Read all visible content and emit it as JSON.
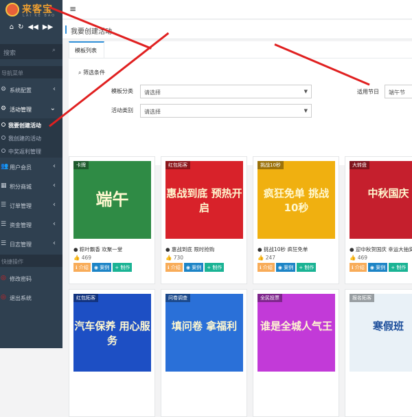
{
  "brand": {
    "name": "来客宝",
    "slogan": "LAI KE BAO"
  },
  "sidebar": {
    "search_placeholder": "搜索",
    "nav_section": "导航菜单",
    "items": [
      {
        "label": "系统配置",
        "icon": "gear-icon",
        "glyph": "⚙",
        "arrow": "‹"
      },
      {
        "label": "活动管理",
        "icon": "gear-icon",
        "glyph": "⚙",
        "arrow": "⌄"
      },
      {
        "label": "用户会员",
        "icon": "users-icon",
        "glyph": "👥",
        "arrow": "‹"
      },
      {
        "label": "积分商城",
        "icon": "grid-icon",
        "glyph": "▦",
        "arrow": "‹"
      },
      {
        "label": "订单管理",
        "icon": "list-icon",
        "glyph": "☰",
        "arrow": "‹"
      },
      {
        "label": "资金管理",
        "icon": "list-icon",
        "glyph": "☰",
        "arrow": "‹"
      },
      {
        "label": "日志管理",
        "icon": "list-icon",
        "glyph": "☰",
        "arrow": "‹"
      }
    ],
    "subitems": [
      "我要创建活动",
      "我创建的活动",
      "中奖返利管理"
    ],
    "quick_section": "快捷操作",
    "quick": [
      {
        "label": "修改密码"
      },
      {
        "label": "退出系统"
      }
    ]
  },
  "topbar": {
    "menu_glyph": "≡"
  },
  "page": {
    "title": "我要创建活动"
  },
  "panel": {
    "tab": "模板列表",
    "filter_title": "筛选条件",
    "filters": {
      "category": {
        "label": "模板分类",
        "value": "请选择"
      },
      "type": {
        "label": "活动类别",
        "value": "请选择"
      },
      "holiday": {
        "label": "适用节日",
        "value": "端午节"
      }
    }
  },
  "cards": [
    {
      "tag": "卡牌",
      "title": "端午",
      "caption": "● 粽叶飘香 欢聚一堂",
      "likes": "469",
      "color": "#2f8b45"
    },
    {
      "tag": "红包拓客",
      "title": "惠战到底 预热开启",
      "caption": "● 惠战到底 限时抢购",
      "likes": "730",
      "color": "#d8222a"
    },
    {
      "tag": "挑战10秒",
      "title": "疯狂免单 挑战10秒",
      "caption": "● 挑战10秒 疯狂免单",
      "likes": "247",
      "color": "#f0b010"
    },
    {
      "tag": "大转盘",
      "title": "中秋国庆",
      "caption": "● 迎中秋贺国庆 幸运大抽奖",
      "likes": "469",
      "color": "#c51f2d"
    },
    {
      "tag": "红包拓客",
      "title": "汽车保养 用心服务",
      "color": "#1d4fc4"
    },
    {
      "tag": "问卷调查",
      "title": "填问卷 拿福利",
      "color": "#2a70d8"
    },
    {
      "tag": "全民投票",
      "title": "谁是全城人气王",
      "color": "#c23ad8"
    },
    {
      "tag": "报名拓客",
      "title": "寒假班",
      "color": "#e9f1f7"
    }
  ],
  "buttons": {
    "intro": "介绍",
    "case": "案例",
    "make": "制作"
  }
}
